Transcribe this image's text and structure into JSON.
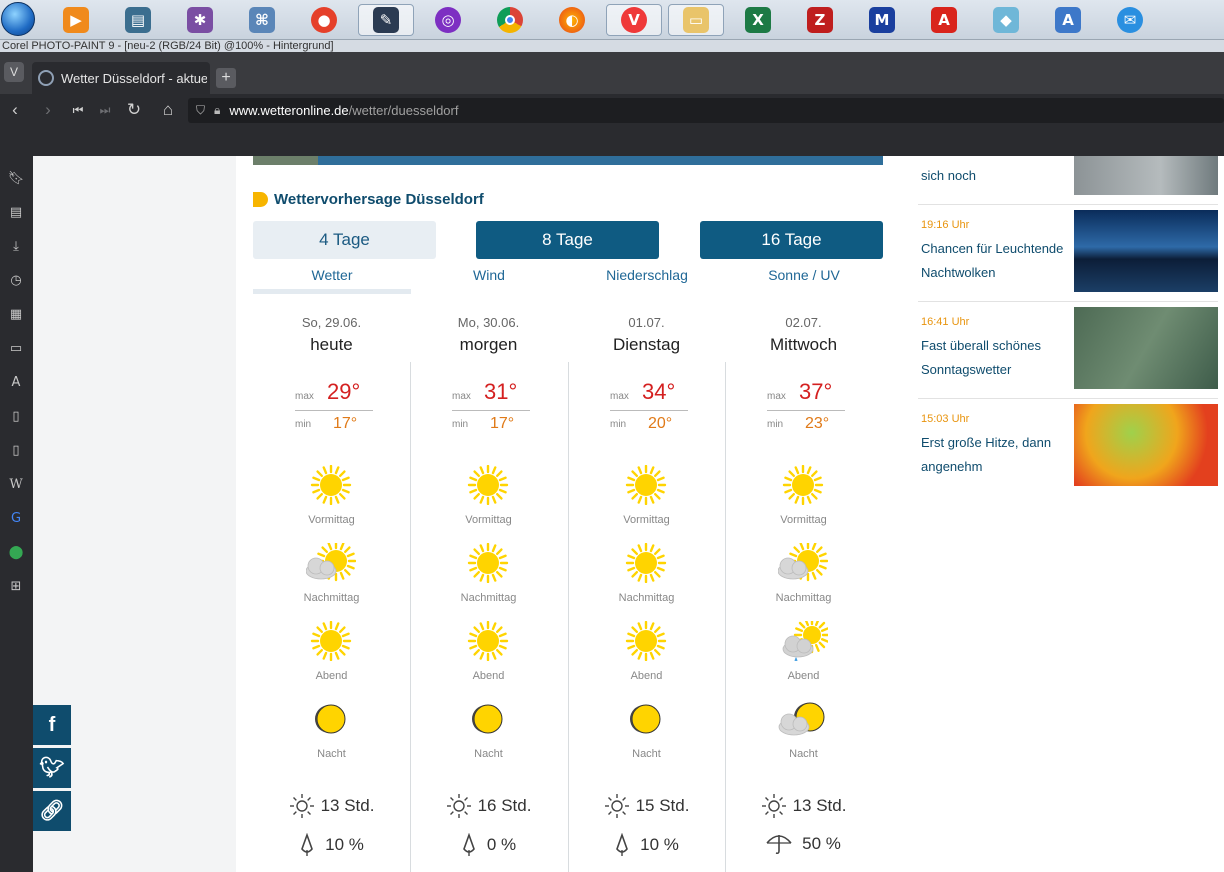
{
  "taskbar": {
    "apps": [
      "start-orb",
      "media-player",
      "image-viewer",
      "spider-app",
      "atlas-app",
      "balloon-app",
      "corel-photo-paint",
      "tor-browser",
      "chrome",
      "firefox",
      "vivaldi",
      "file-explorer",
      "excel",
      "filezilla",
      "rm-app",
      "acrobat",
      "glass-app",
      "wordpad",
      "thunderbird"
    ]
  },
  "corel_title": "Corel PHOTO-PAINT 9 - [neu-2 (RGB/24 Bit) @100% - Hintergrund]",
  "browser": {
    "tab_title": "Wetter Düsseldorf - aktuelles Wetter",
    "url_domain": "www.wetteronline.de",
    "url_path": "/wetter/duesseldorf"
  },
  "forecast": {
    "heading": "Wettervorhersage Düsseldorf",
    "day_buttons": [
      "4 Tage",
      "8 Tage",
      "16 Tage"
    ],
    "sub_tabs": [
      "Wetter",
      "Wind",
      "Niederschlag",
      "Sonne / UV"
    ],
    "max_label": "max",
    "min_label": "min",
    "days": [
      {
        "date": "So, 29.06.",
        "name": "heute",
        "max": "29°",
        "min": "17°",
        "periods": [
          {
            "label": "Vormittag",
            "icon": "sun"
          },
          {
            "label": "Nachmittag",
            "icon": "sun-cloud"
          },
          {
            "label": "Abend",
            "icon": "sun"
          },
          {
            "label": "Nacht",
            "icon": "moon"
          }
        ],
        "sun_hours": "13 Std.",
        "rain": "10 %",
        "rain_icon": "drop"
      },
      {
        "date": "Mo, 30.06.",
        "name": "morgen",
        "max": "31°",
        "min": "17°",
        "periods": [
          {
            "label": "Vormittag",
            "icon": "sun"
          },
          {
            "label": "Nachmittag",
            "icon": "sun"
          },
          {
            "label": "Abend",
            "icon": "sun"
          },
          {
            "label": "Nacht",
            "icon": "moon"
          }
        ],
        "sun_hours": "16 Std.",
        "rain": "0 %",
        "rain_icon": "drop"
      },
      {
        "date": "01.07.",
        "name": "Dienstag",
        "max": "34°",
        "min": "20°",
        "periods": [
          {
            "label": "Vormittag",
            "icon": "sun"
          },
          {
            "label": "Nachmittag",
            "icon": "sun"
          },
          {
            "label": "Abend",
            "icon": "sun"
          },
          {
            "label": "Nacht",
            "icon": "moon"
          }
        ],
        "sun_hours": "15 Std.",
        "rain": "10 %",
        "rain_icon": "drop"
      },
      {
        "date": "02.07.",
        "name": "Mittwoch",
        "max": "37°",
        "min": "23°",
        "periods": [
          {
            "label": "Vormittag",
            "icon": "sun"
          },
          {
            "label": "Nachmittag",
            "icon": "sun-cloud"
          },
          {
            "label": "Abend",
            "icon": "sun-cloud-rain"
          },
          {
            "label": "Nacht",
            "icon": "moon-cloud"
          }
        ],
        "sun_hours": "13 Std.",
        "rain": "50 %",
        "rain_icon": "umbrella"
      }
    ]
  },
  "news": [
    {
      "time": "",
      "title": "sich noch"
    },
    {
      "time": "19:16 Uhr",
      "title": "Chancen für Leuchtende Nachtwolken"
    },
    {
      "time": "16:41 Uhr",
      "title": "Fast überall schönes Sonntagswetter"
    },
    {
      "time": "15:03 Uhr",
      "title": "Erst große Hitze, dann angenehm"
    }
  ],
  "colors": {
    "brand": "#0f5b82",
    "max_temp": "#d42020",
    "min_temp": "#e07a18",
    "news_time": "#e8940e",
    "sun": "#ffd400"
  }
}
